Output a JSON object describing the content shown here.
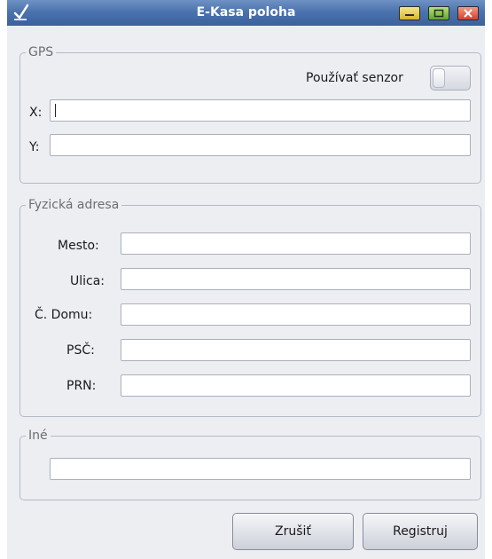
{
  "window": {
    "title": "E-Kasa poloha",
    "icon": "checkmark-icon",
    "controls": [
      "minimize-icon",
      "maximize-icon",
      "close-icon"
    ]
  },
  "gps": {
    "group_title": "GPS",
    "sensor_label": "Používať senzor",
    "sensor_on": false,
    "x_label": "X:",
    "x_value": "",
    "y_label": "Y:",
    "y_value": ""
  },
  "address": {
    "group_title": "Fyzická adresa",
    "city_label": "Mesto:",
    "city_value": "",
    "street_label": "Ulica:",
    "street_value": "",
    "house_no_label": "Č. Domu:",
    "house_no_value": "",
    "zip_label": "PSČ:",
    "zip_value": "",
    "prn_label": "PRN:",
    "prn_value": ""
  },
  "other": {
    "group_title": "Iné",
    "value": ""
  },
  "buttons": {
    "cancel": "Zrušiť",
    "register": "Registruj"
  }
}
